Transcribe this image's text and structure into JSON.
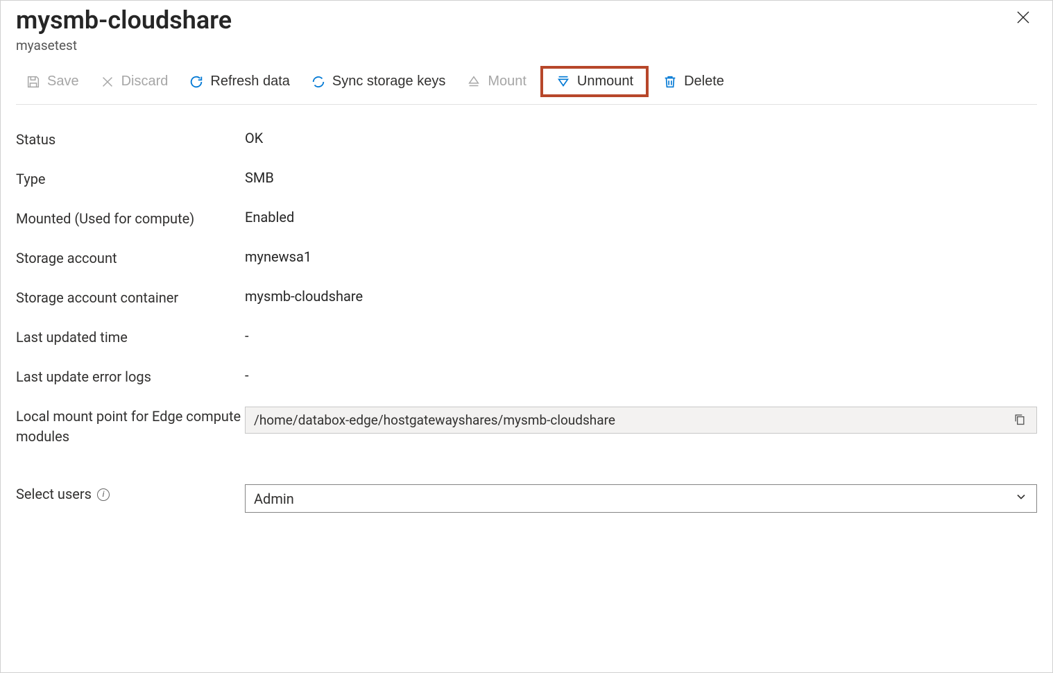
{
  "header": {
    "title": "mysmb-cloudshare",
    "subtitle": "myasetest"
  },
  "toolbar": {
    "save": "Save",
    "discard": "Discard",
    "refresh": "Refresh data",
    "sync": "Sync storage keys",
    "mount": "Mount",
    "unmount": "Unmount",
    "delete": "Delete"
  },
  "fields": {
    "status": {
      "label": "Status",
      "value": "OK"
    },
    "type": {
      "label": "Type",
      "value": "SMB"
    },
    "mounted": {
      "label": "Mounted (Used for compute)",
      "value": "Enabled"
    },
    "storage_account": {
      "label": "Storage account",
      "value": "mynewsa1"
    },
    "storage_container": {
      "label": "Storage account container",
      "value": "mysmb-cloudshare"
    },
    "last_updated": {
      "label": "Last updated time",
      "value": "-"
    },
    "last_errors": {
      "label": "Last update error logs",
      "value": "-"
    },
    "mount_point": {
      "label": "Local mount point for Edge compute modules",
      "value": "/home/databox-edge/hostgatewayshares/mysmb-cloudshare"
    },
    "select_users": {
      "label": "Select users",
      "value": "Admin"
    }
  }
}
